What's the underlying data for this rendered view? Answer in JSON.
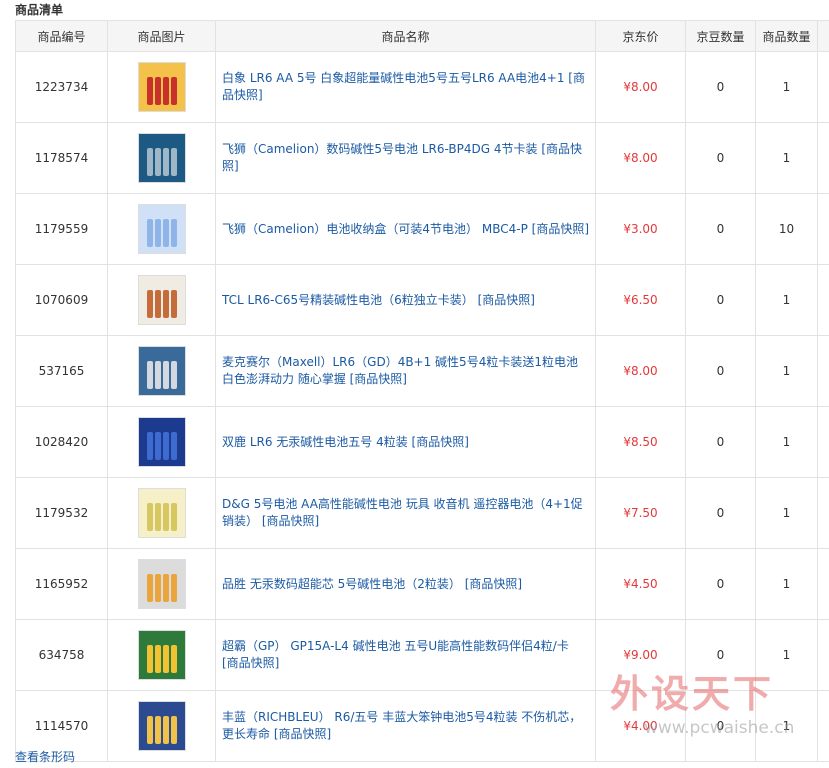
{
  "title": "商品清单",
  "headers": [
    "商品编号",
    "商品图片",
    "商品名称",
    "京东价",
    "京豆数量",
    "商品数量"
  ],
  "rows": [
    {
      "id": "1223734",
      "name": "白象 LR6 AA 5号 白象超能量碱性电池5号五号LR6 AA电池4+1 [商品快照]",
      "price": "¥8.00",
      "beans": "0",
      "qty": "1",
      "op": "B"
    },
    {
      "id": "1178574",
      "name": "飞狮（Camelion）数码碱性5号电池 LR6-BP4DG 4节卡装 [商品快照]",
      "price": "¥8.00",
      "beans": "0",
      "qty": "1",
      "op": "B"
    },
    {
      "id": "1179559",
      "name": "飞狮（Camelion）电池收纳盒（可装4节电池） MBC4-P [商品快照]",
      "price": "¥3.00",
      "beans": "0",
      "qty": "10",
      "op": "B"
    },
    {
      "id": "1070609",
      "name": "TCL LR6-C65号精装碱性电池（6粒独立卡装） [商品快照]",
      "price": "¥6.50",
      "beans": "0",
      "qty": "1",
      "op": "B"
    },
    {
      "id": "537165",
      "name": "麦克赛尔（Maxell）LR6（GD）4B+1 碱性5号4粒卡装送1粒电池 白色澎湃动力 随心掌握 [商品快照]",
      "price": "¥8.00",
      "beans": "0",
      "qty": "1",
      "op": "B"
    },
    {
      "id": "1028420",
      "name": "双鹿 LR6 无汞碱性电池五号 4粒装 [商品快照]",
      "price": "¥8.50",
      "beans": "0",
      "qty": "1",
      "op": "B"
    },
    {
      "id": "1179532",
      "name": "D&G 5号电池 AA高性能碱性电池 玩具 收音机 遥控器电池（4+1促销装） [商品快照]",
      "price": "¥7.50",
      "beans": "0",
      "qty": "1",
      "op": "B"
    },
    {
      "id": "1165952",
      "name": "品胜 无汞数码超能芯 5号碱性电池（2粒装） [商品快照]",
      "price": "¥4.50",
      "beans": "0",
      "qty": "1",
      "op": "B"
    },
    {
      "id": "634758",
      "name": "超霸（GP） GP15A-L4 碱性电池 五号U能高性能数码伴侣4粒/卡 [商品快照]",
      "price": "¥9.00",
      "beans": "0",
      "qty": "1",
      "op": "B"
    },
    {
      "id": "1114570",
      "name": "丰蓝（RICHBLEU） R6/五号 丰蓝大笨钟电池5号4粒装 不伤机芯，更长寿命 [商品快照]",
      "price": "¥4.00",
      "beans": "0",
      "qty": "1",
      "op": "B"
    }
  ],
  "thumbs": [
    {
      "bg": "#f4c24a",
      "cell": "#c8302b"
    },
    {
      "bg": "#1c5a84",
      "cell": "#9fb6c7"
    },
    {
      "bg": "#cfe0f7",
      "cell": "#8fb5e8"
    },
    {
      "bg": "#f0ece4",
      "cell": "#c46d3a"
    },
    {
      "bg": "#3a6a9a",
      "cell": "#d4d9df"
    },
    {
      "bg": "#1c3b8f",
      "cell": "#3d6bd0"
    },
    {
      "bg": "#f6f0c8",
      "cell": "#d7c760"
    },
    {
      "bg": "#dcdcdc",
      "cell": "#e9a53c"
    },
    {
      "bg": "#2e7a3a",
      "cell": "#f2c233"
    },
    {
      "bg": "#2c4a8f",
      "cell": "#f0c24a"
    }
  ],
  "footer_link": "查看条形码",
  "watermark": {
    "brand": "外设天下",
    "url": "www.pcwaishe.cn"
  }
}
